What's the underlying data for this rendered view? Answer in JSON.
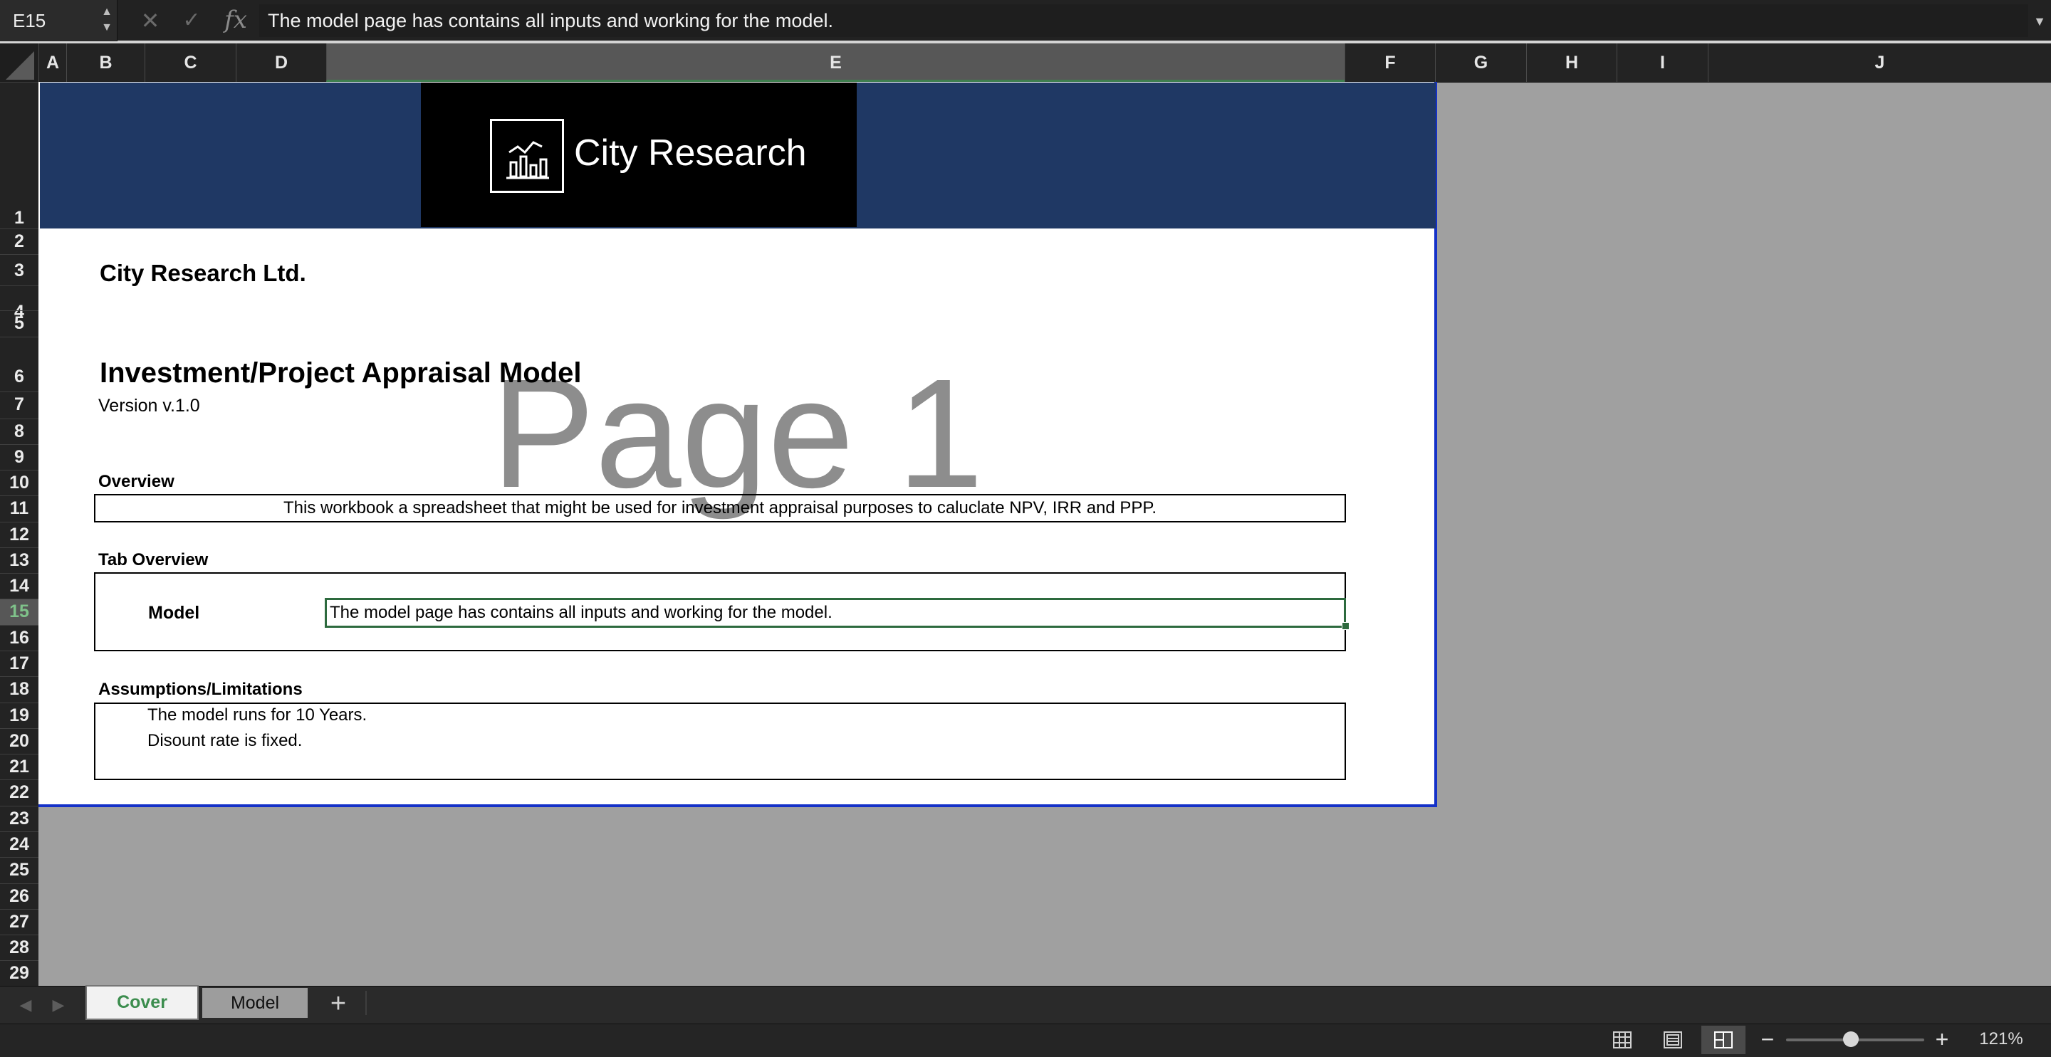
{
  "formula_bar": {
    "name_box": "E15",
    "formula": "The model page has contains all inputs and working for the model."
  },
  "columns": [
    "A",
    "B",
    "C",
    "D",
    "E",
    "F",
    "G",
    "H",
    "I",
    "J"
  ],
  "selected_column": "E",
  "rows": [
    "1",
    "2",
    "3",
    "4",
    "5",
    "6",
    "7",
    "8",
    "9",
    "10",
    "11",
    "12",
    "13",
    "14",
    "15",
    "16",
    "17",
    "18",
    "19",
    "20",
    "21",
    "22",
    "23",
    "24",
    "25",
    "26",
    "27",
    "28",
    "29"
  ],
  "selected_row": "15",
  "sheet": {
    "logo_text": "City Research",
    "company": "City Research Ltd.",
    "title": "Investment/Project Appraisal Model",
    "version": "Version v.1.0",
    "watermark": "Page 1",
    "overview_heading": "Overview",
    "overview_text": "This workbook a spreadsheet that might be used for investment appraisal purposes to caluclate NPV, IRR and PPP.",
    "tab_overview_heading": "Tab Overview",
    "tab_overview": [
      {
        "name": "Model",
        "description": "The model page has contains all inputs and working for the model."
      }
    ],
    "assumptions_heading": "Assumptions/Limitations",
    "assumptions": [
      "The model runs for 10 Years.",
      "Disount rate is fixed."
    ]
  },
  "sheet_tabs": [
    {
      "label": "Cover",
      "active": true
    },
    {
      "label": "Model",
      "active": false
    }
  ],
  "status_bar": {
    "zoom": "121%",
    "zoom_fraction": 0.47,
    "view": "page-layout"
  },
  "colors": {
    "banner": "#1f3864",
    "selection": "#2d6a3e",
    "page_border": "#1431c8"
  },
  "icons": {
    "cancel": "close-icon",
    "enter": "checkmark-icon",
    "function": "fx-icon",
    "logo": "chart-logo-icon"
  }
}
